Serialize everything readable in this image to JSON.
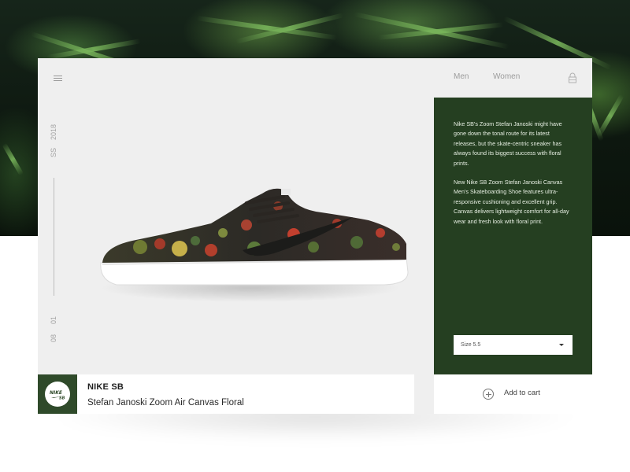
{
  "nav": {
    "men": "Men",
    "women": "Women"
  },
  "season": {
    "code": "SS",
    "year": "2018",
    "day": "01",
    "month": "08"
  },
  "panel": {
    "paragraph_1": "Nike SB's Zoom Stefan Janoski might have gone down the tonal route for its latest releases, but the skate-centric sneaker has always found its biggest success with floral prints.",
    "paragraph_2": "New  Nike SB Zoom Stefan Janoski Canvas Men's Skateboarding Shoe features ultra-responsive cushioning and excellent grip. Canvas delivers lightweight comfort for all-day wear and fresh look with floral print."
  },
  "size": {
    "selected": "Size 5.5"
  },
  "product": {
    "brand": "NIKE SB",
    "name": "Stefan Janoski Zoom Air Canvas Floral"
  },
  "logo": {
    "text": "Nike SB"
  },
  "cart": {
    "label": "Add to cart"
  },
  "icons": {
    "menu": "menu-icon",
    "lock": "lock-icon",
    "plus": "plus-icon",
    "dropdown": "chevron-down-icon"
  },
  "colors": {
    "panel": "#253f21",
    "card": "#efefef",
    "logo_bg": "#2f4a2a"
  }
}
